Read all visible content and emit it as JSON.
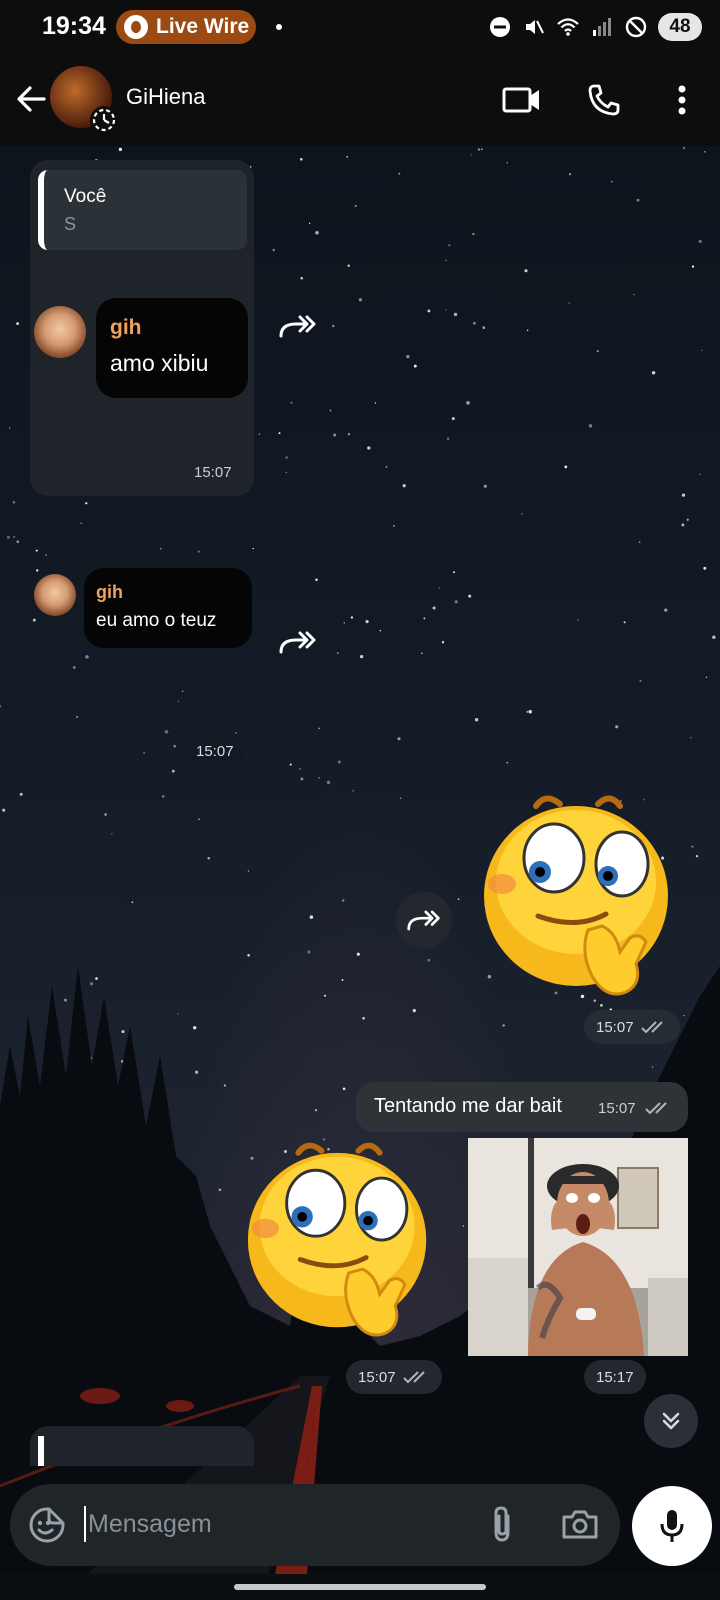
{
  "status_bar": {
    "time": "19:34",
    "live_badge": "Live Wire",
    "battery": "48",
    "icons": [
      "do-not-disturb-icon",
      "mute-icon",
      "wifi-icon",
      "signal-icon",
      "blocked-icon"
    ]
  },
  "header": {
    "contact_name": "GiHiena",
    "icons": [
      "back-arrow-icon",
      "video-call-icon",
      "phone-icon",
      "more-vert-icon"
    ]
  },
  "messages": {
    "m1": {
      "reply_name": "Você",
      "reply_text": "S",
      "fwd_name": "gih",
      "fwd_text": "amo xibiu",
      "time": "15:07"
    },
    "m2": {
      "fwd_name": "gih",
      "fwd_text": "eu amo o teuz",
      "time": "15:07"
    },
    "m3": {
      "type": "sticker",
      "time": "15:07"
    },
    "m4": {
      "text": "Tentando me dar bait",
      "time": "15:07"
    },
    "m5": {
      "type": "sticker",
      "time": "15:07"
    },
    "m6": {
      "type": "photo",
      "time": "15:17"
    }
  },
  "composer": {
    "placeholder": "Mensagem",
    "icons": [
      "emoji-icon",
      "attach-icon",
      "camera-icon",
      "mic-icon"
    ]
  },
  "colors": {
    "sender_name": "#f0a25a",
    "header_bg": "#0d0d0d",
    "badge_bg": "#9a4a12",
    "bubble_in": "#1e2429",
    "bubble_out": "#2d3337"
  }
}
